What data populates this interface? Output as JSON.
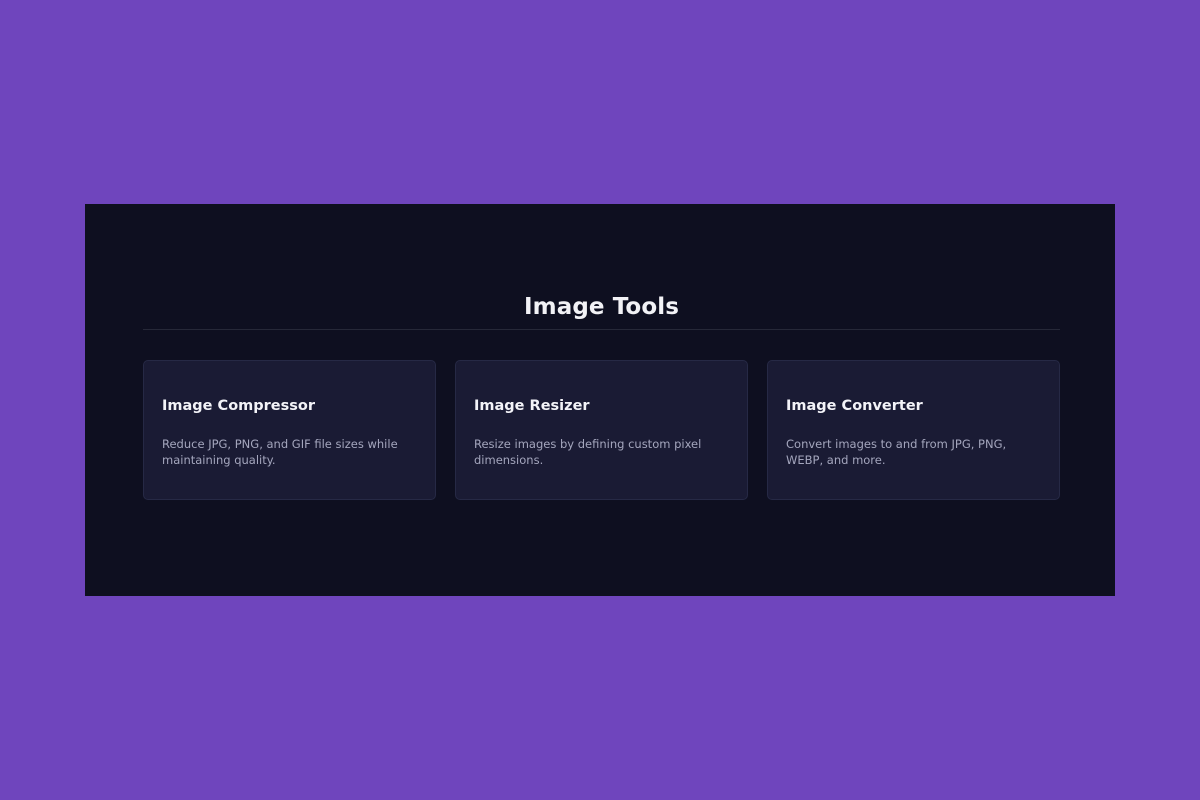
{
  "section": {
    "title": "Image Tools"
  },
  "cards": [
    {
      "title": "Image Compressor",
      "description": "Reduce JPG, PNG, and GIF file sizes while maintaining quality."
    },
    {
      "title": "Image Resizer",
      "description": "Resize images by defining custom pixel dimensions."
    },
    {
      "title": "Image Converter",
      "description": "Convert images to and from JPG, PNG, WEBP, and more."
    }
  ],
  "colors": {
    "page_background": "#6f45bd",
    "panel_background": "#0e0f20",
    "card_background": "#1a1b34",
    "title_text": "#f2f2f6",
    "description_text": "#a4a6bd"
  }
}
